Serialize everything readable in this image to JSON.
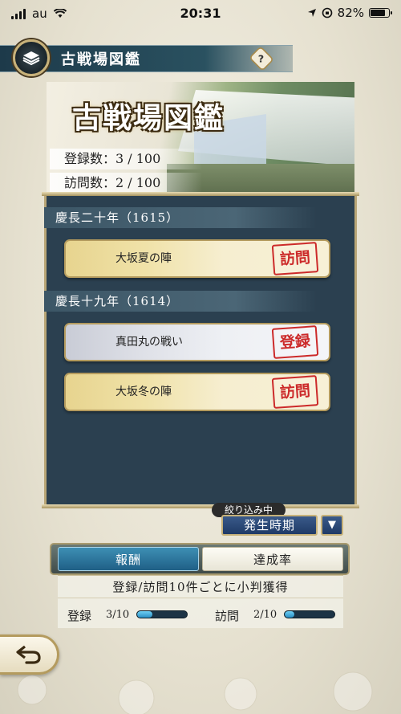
{
  "status_bar": {
    "carrier": "au",
    "time": "20:31",
    "battery": "82%"
  },
  "header": {
    "title": "古戦場図鑑",
    "help_label": "?"
  },
  "banner": {
    "title": "古戦場図鑑",
    "registered_label": "登録数：3 / 100",
    "visited_label": "訪問数：2 / 100"
  },
  "groups": [
    {
      "label": "慶長二十年（1615）",
      "items": [
        {
          "name": "大坂夏の陣",
          "stamp": "訪問",
          "status": "visited"
        }
      ]
    },
    {
      "label": "慶長十九年（1614）",
      "items": [
        {
          "name": "真田丸の戦い",
          "stamp": "登録",
          "status": "registered"
        },
        {
          "name": "大坂冬の陣",
          "stamp": "訪問",
          "status": "visited"
        }
      ]
    }
  ],
  "filter": {
    "label": "絞り込み中",
    "value": "発生時期",
    "toggle": "▼"
  },
  "tabs": [
    {
      "label": "報酬",
      "active": true
    },
    {
      "label": "達成率",
      "active": false
    }
  ],
  "reward": {
    "text": "登録/訪問10件ごとに小判獲得",
    "register_label": "登録",
    "register_count": "3/10",
    "register_progress": 0.3,
    "visit_label": "訪問",
    "visit_count": "2/10",
    "visit_progress": 0.2
  },
  "colors": {
    "accent": "#2a5160",
    "stamp_red": "#cc2a2a",
    "progress": "#2a8fc4"
  }
}
